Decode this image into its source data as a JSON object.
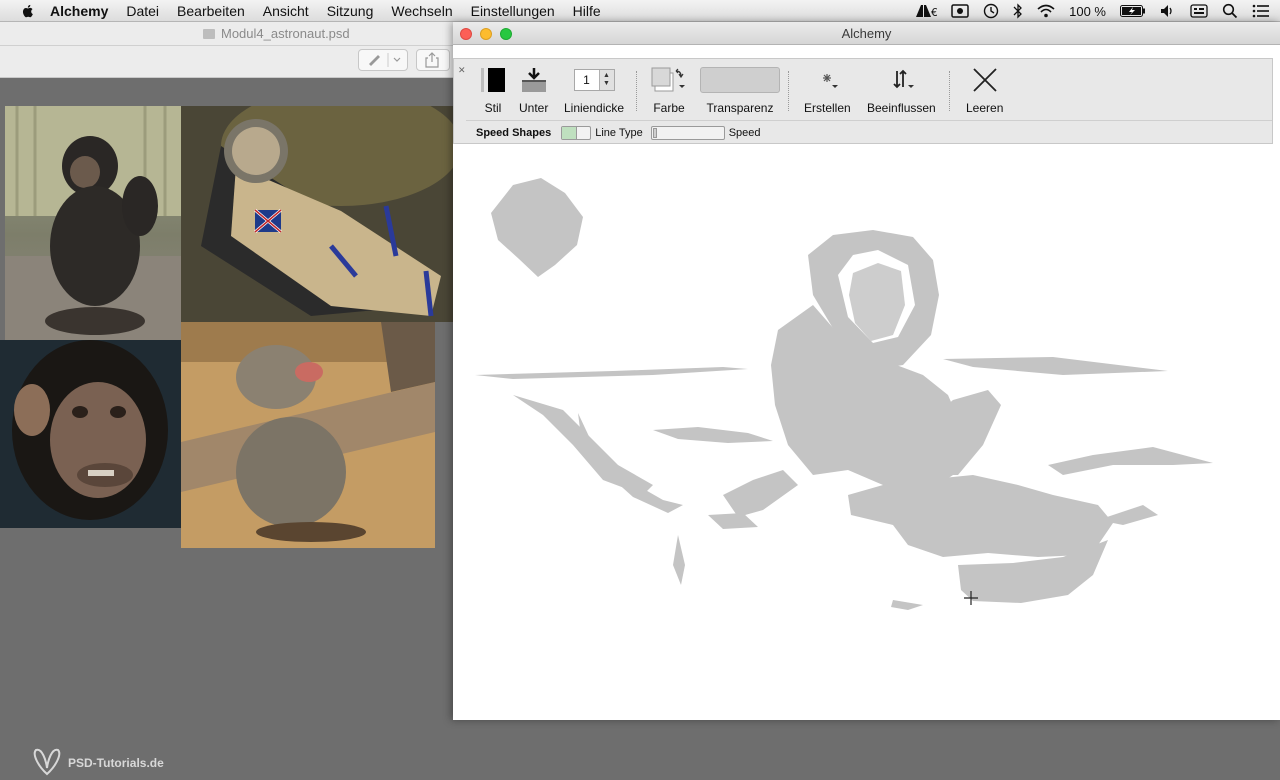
{
  "menubar": {
    "app_name": "Alchemy",
    "items": [
      "Datei",
      "Bearbeiten",
      "Ansicht",
      "Sitzung",
      "Wechseln",
      "Einstellungen",
      "Hilfe"
    ],
    "battery": "100 %"
  },
  "photoshop": {
    "document_title": "Modul4_astronaut.psd",
    "watermark": "PSD-Tutorials.de"
  },
  "alchemy": {
    "window_title": "Alchemy",
    "toolbar": {
      "stil": "Stil",
      "unter": "Unter",
      "linewidth_value": "1",
      "liniendicke": "Liniendicke",
      "farbe": "Farbe",
      "transparenz": "Transparenz",
      "erstellen": "Erstellen",
      "beeinflussen": "Beeinflussen",
      "leeren": "Leeren"
    },
    "subbar": {
      "title": "Speed Shapes",
      "line_type": "Line Type",
      "speed": "Speed"
    }
  },
  "colors": {
    "sketch_gray": "#c4c4c4",
    "close": "#fc5f57",
    "minimize": "#fdbc2e",
    "zoom": "#28c840"
  }
}
